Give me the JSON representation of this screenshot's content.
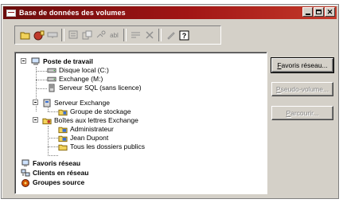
{
  "window": {
    "title": "Base de données des volumes",
    "controls": [
      "minimize",
      "maximize",
      "close"
    ]
  },
  "toolbar": {
    "icons": [
      "open-folder-icon",
      "add-volume-icon",
      "network-drive-icon",
      "properties-icon",
      "server-properties-icon",
      "connect-icon",
      "rename-icon",
      "list-icon",
      "delete-icon",
      "filter-icon",
      "help-icon"
    ],
    "abl_label": "abl"
  },
  "tree": {
    "nodes": [
      {
        "label": "Poste de travail",
        "bold": true,
        "icon": "computer-icon"
      },
      {
        "label": "Disque local (C:)",
        "bold": false,
        "icon": "drive-icon"
      },
      {
        "label": "Exchange (M:)",
        "bold": false,
        "icon": "drive-icon"
      },
      {
        "label": "Serveur SQL (sans licence)",
        "bold": false,
        "icon": "sql-server-icon"
      },
      {
        "label": "Serveur Exchange",
        "bold": false,
        "icon": "exchange-server-icon"
      },
      {
        "label": "Groupe de stockage",
        "bold": false,
        "icon": "storage-group-icon"
      },
      {
        "label": "Boîtes aux lettres Exchange",
        "bold": false,
        "icon": "mailboxes-icon"
      },
      {
        "label": "Administrateur",
        "bold": false,
        "icon": "mailbox-icon"
      },
      {
        "label": "Jean Dupont",
        "bold": false,
        "icon": "mailbox-icon"
      },
      {
        "label": "Tous les dossiers publics",
        "bold": false,
        "icon": "public-folders-icon"
      },
      {
        "label": "Favoris réseau",
        "bold": true,
        "icon": "network-favorites-icon"
      },
      {
        "label": "Clients en réseau",
        "bold": true,
        "icon": "network-clients-icon"
      },
      {
        "label": "Groupes source",
        "bold": true,
        "icon": "source-groups-icon"
      }
    ]
  },
  "buttons": {
    "favoris_u": "F",
    "favoris_rest": "avoris réseau...",
    "pseudo_u": "P",
    "pseudo_rest": "seudo-volume...",
    "parcourir_u": "P",
    "parcourir_rest": "arcourir..."
  }
}
